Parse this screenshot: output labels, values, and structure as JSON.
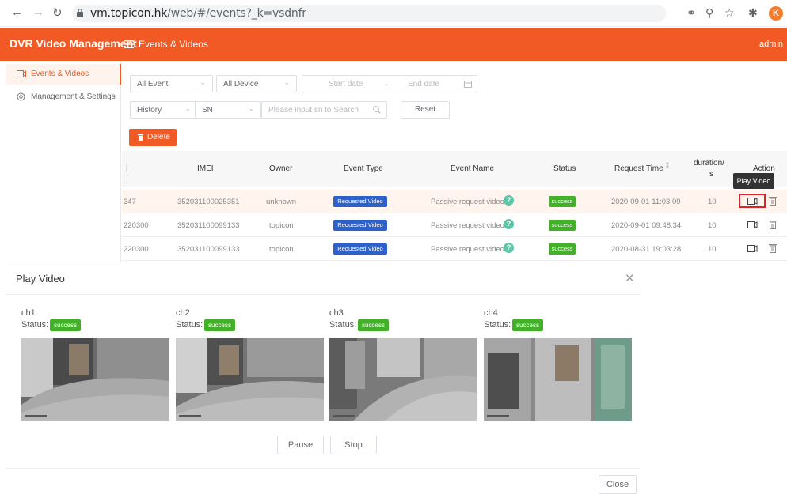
{
  "browser": {
    "url_host": "vm.topicon.hk",
    "url_path": "/web/#/events?_k=vsdnfr",
    "profile_letter": "K"
  },
  "app": {
    "title": "DVR Video Management",
    "breadcrumb": "Events & Videos",
    "user": "admin"
  },
  "sidebar": {
    "items": [
      {
        "label": "Events & Videos",
        "icon": "video-camera-icon",
        "active": true
      },
      {
        "label": "Management & Settings",
        "icon": "gear-icon",
        "active": false
      }
    ]
  },
  "filters": {
    "event_type": "All Event",
    "device": "All Device",
    "start_date_placeholder": "Start date",
    "end_date_placeholder": "End date",
    "mode": "History",
    "field": "SN",
    "search_placeholder": "Please input sn to Search",
    "reset_label": "Reset"
  },
  "actions": {
    "delete_label": "Delete"
  },
  "table": {
    "columns": [
      "IMEI",
      "Owner",
      "Event Type",
      "Event Name",
      "Status",
      "Request Time",
      "duration/",
      "s",
      "Action"
    ],
    "rows": [
      {
        "sn": "347",
        "imei": "352031100025351",
        "owner": "unknown",
        "event_type": "Requested Video",
        "event_name": "Passive request video",
        "status": "success",
        "request_time": "2020-09-01 11:03:09",
        "duration": "10"
      },
      {
        "sn": "220300",
        "imei": "352031100099133",
        "owner": "topicon",
        "event_type": "Requested Video",
        "event_name": "Passive request video",
        "status": "success",
        "request_time": "2020-09-01 09:48:34",
        "duration": "10"
      },
      {
        "sn": "220300",
        "imei": "352031100099133",
        "owner": "topicon",
        "event_type": "Requested Video",
        "event_name": "Passive request video",
        "status": "success",
        "request_time": "2020-08-31 19:03:28",
        "duration": "10"
      }
    ],
    "tooltip": "Play Video"
  },
  "modal": {
    "title": "Play Video",
    "status_label": "Status:",
    "channels": [
      {
        "name": "ch1",
        "status": "success"
      },
      {
        "name": "ch2",
        "status": "success"
      },
      {
        "name": "ch3",
        "status": "success"
      },
      {
        "name": "ch4",
        "status": "success"
      }
    ],
    "pause_label": "Pause",
    "stop_label": "Stop",
    "close_label": "Close"
  },
  "colors": {
    "brand": "#f15a24",
    "success": "#43b02a",
    "event_badge": "#2d61c9"
  }
}
